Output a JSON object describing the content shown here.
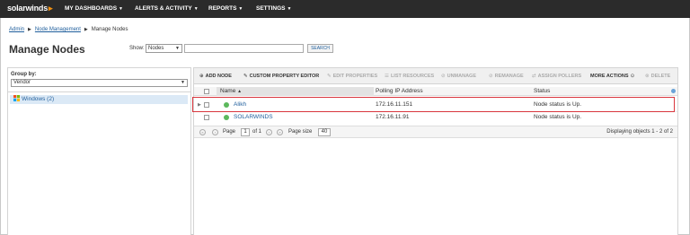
{
  "topnav": {
    "logo": "solarwinds",
    "items": [
      {
        "label": "MY DASHBOARDS"
      },
      {
        "label": "ALERTS & ACTIVITY"
      },
      {
        "label": "REPORTS"
      },
      {
        "label": "SETTINGS"
      }
    ]
  },
  "breadcrumb": [
    "Admin",
    "Node Management",
    "Manage Nodes"
  ],
  "page_title": "Manage Nodes",
  "search": {
    "show_label": "Show:",
    "show_value": "Nodes",
    "search_value": "",
    "search_button": "SEARCH"
  },
  "group": {
    "label": "Group by:",
    "value": "Vendor",
    "items": [
      {
        "label": "Windows (2)"
      }
    ]
  },
  "toolbar": {
    "add_node": "ADD NODE",
    "custom_property_editor": "CUSTOM PROPERTY EDITOR",
    "edit_properties": "EDIT PROPERTIES",
    "list_resources": "LIST RESOURCES",
    "unmanage": "UNMANAGE",
    "remanage": "REMANAGE",
    "assign_pollers": "ASSIGN POLLERS",
    "more_actions": "MORE ACTIONS",
    "delete": "DELETE"
  },
  "table": {
    "columns": {
      "name": "Name",
      "ip": "Polling IP Address",
      "status": "Status"
    },
    "rows": [
      {
        "name": "Alikh",
        "ip": "172.16.11.151",
        "status": "Node status is Up."
      },
      {
        "name": "SOLARWINDS",
        "ip": "172.16.11.91",
        "status": "Node status is Up."
      }
    ]
  },
  "pager": {
    "page_label": "Page",
    "page_value": "1",
    "of_label": "of 1",
    "page_size_label": "Page size",
    "page_size_value": "40",
    "display_text": "Displaying objects 1 - 2 of 2"
  },
  "colors": {
    "accent": "#1f5e9c",
    "status_up": "#5cb85c",
    "highlight": "#d9363e",
    "nav_bg": "#2b2b2b"
  }
}
